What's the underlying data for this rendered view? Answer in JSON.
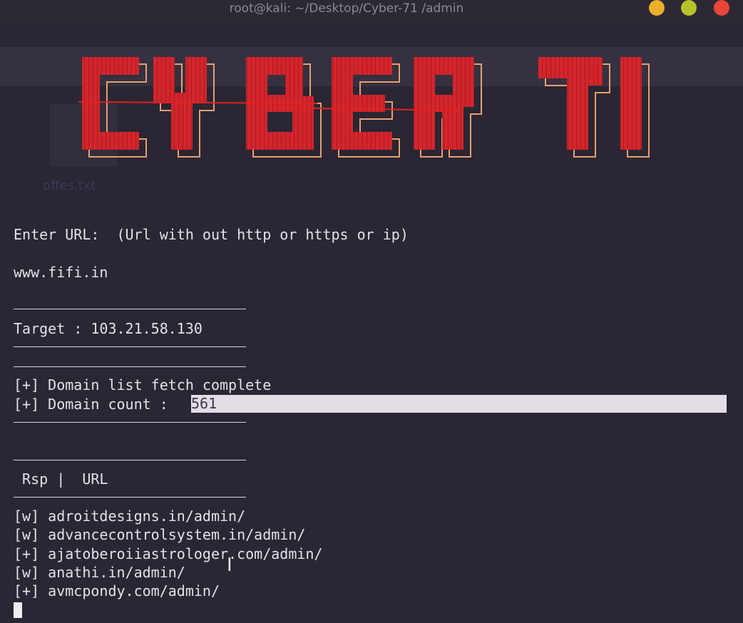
{
  "window": {
    "title": "root@kali: ~/Desktop/Cyber-71 /admin"
  },
  "banner": {
    "text": "CYBER 71",
    "fill_color": "#d4252c",
    "outline_color": "#e8a070"
  },
  "background_ghost": {
    "text": "offes.txt"
  },
  "terminal": {
    "prompt_line": "Enter URL:  (Url with out http or https or ip)",
    "url_input": "www.fifi.in",
    "target_line": "Target : 103.21.58.130",
    "fetch_status": "[+] Domain list fetch complete",
    "count_label": "[+] Domain count : ",
    "count_value": "561",
    "table_header": " Rsp |  URL",
    "results": [
      "[w] adroitdesigns.in/admin/",
      "[w] advancecontrolsystem.in/admin/",
      "[+] ajatoberoiiastrologer.com/admin/",
      "[w] anathi.in/admin/",
      "[+] avmcpondy.com/admin/"
    ]
  },
  "icons": {
    "ibeam": "text-cursor-icon"
  }
}
